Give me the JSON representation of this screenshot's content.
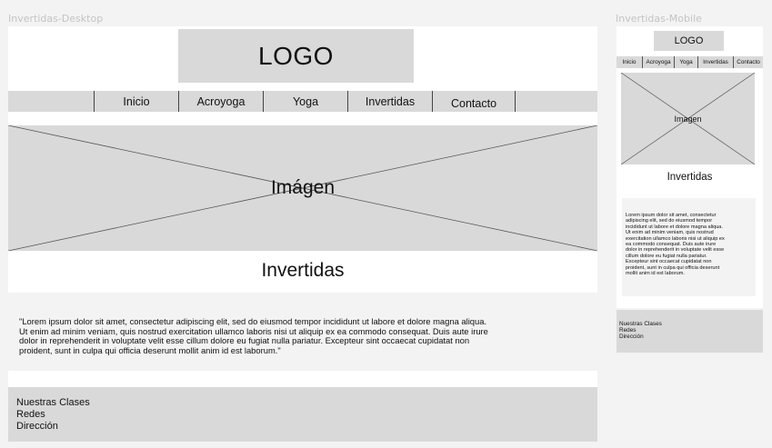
{
  "desktop": {
    "frame_label": "Invertidas-Desktop",
    "logo": "LOGO",
    "nav": [
      "Inicio",
      "Acroyoga",
      "Yoga",
      "Invertidas",
      "Contacto"
    ],
    "image_label": "Imágen",
    "title": "Invertidas",
    "quote_lines": [
      "\"Lorem ipsum dolor sit amet, consectetur adipiscing elit, sed do eiusmod tempor incididunt ut labore et dolore magna aliqua.",
      "Ut enim ad minim veniam, quis nostrud exercitation ullamco laboris nisi ut aliquip ex ea commodo consequat. Duis aute irure",
      "dolor in reprehenderit in voluptate velit esse cillum dolore eu fugiat nulla pariatur. Excepteur sint occaecat cupidatat non",
      "proident, sunt in culpa qui officia deserunt mollit anim id est laborum.\""
    ],
    "footer": [
      "Nuestras Clases",
      "Redes",
      "Dirección"
    ]
  },
  "mobile": {
    "frame_label": "Invertidas-Mobile",
    "logo": "LOGO",
    "nav": [
      "Inicio",
      "Acroyoga",
      "Yoga",
      "Invertidas",
      "Contacto"
    ],
    "image_label": "Imagen",
    "title": "Invertidas",
    "text_lines": [
      "Lorem ipsum dolor sit amet, consectetur",
      "adipiscing elit, sed do eiusmod tempor",
      "incididunt ut labore et dolore magna aliqua.",
      "Ut enim ad minim veniam, quis nostrud",
      "exercitation ullamco laboris nisi ut aliquip ex",
      "ea commodo consequat. Duis aute irure",
      "dolor in reprehenderit in voluptate velit esse",
      "cillum dolore eu fugiat nulla pariatur.",
      "Excepteur sint occaecat cupidatat non",
      "proident, sunt in culpa qui officia deserunt",
      "mollit anim id est laborum."
    ],
    "footer": [
      "Nuestras Clases",
      "Redes",
      "Dirección"
    ]
  }
}
